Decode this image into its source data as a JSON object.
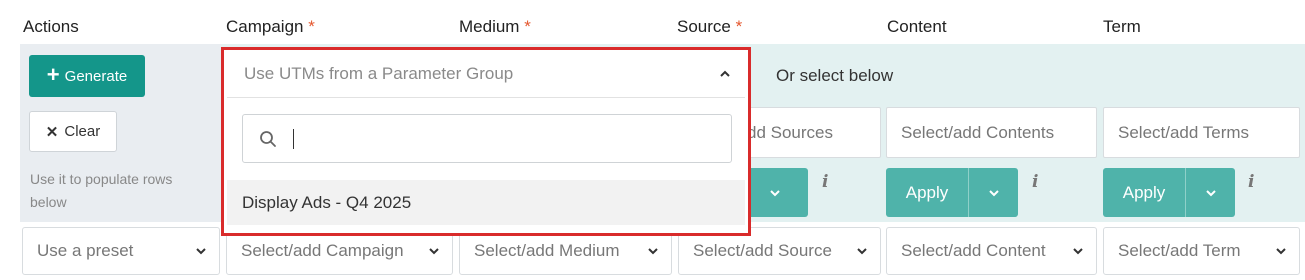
{
  "headers": {
    "actions": "Actions",
    "campaign": "Campaign",
    "medium": "Medium",
    "source": "Source",
    "content": "Content",
    "term": "Term",
    "required_mark": "*"
  },
  "actions": {
    "generate_label": "Generate",
    "clear_label": "Clear",
    "hint": "Use it to populate rows below"
  },
  "parameter_group": {
    "or_select_below": "Or select below"
  },
  "add_fields": {
    "sources": "dd Sources",
    "contents": "Select/add Contents",
    "terms": "Select/add Terms"
  },
  "apply": {
    "label": "Apply"
  },
  "row_selects": {
    "preset": "Use a preset",
    "campaign": "Select/add Campaign",
    "medium": "Select/add Medium",
    "source": "Select/add Source",
    "content": "Select/add Content",
    "term": "Select/add Term"
  },
  "dropdown": {
    "placeholder": "Use UTMs from a Parameter Group",
    "search_value": "",
    "options": [
      "Display Ads - Q4 2025"
    ]
  },
  "colors": {
    "primary": "#14968a",
    "apply": "#4fb3aa",
    "required": "#e4572e",
    "highlight_border": "#d92b2b",
    "row_background": "#e3f1f1"
  },
  "icons": {
    "plus": "plus-icon",
    "close": "close-icon",
    "chevron_down": "chevron-down-icon",
    "chevron_up": "chevron-up-icon",
    "search": "search-icon",
    "info": "info-icon"
  }
}
